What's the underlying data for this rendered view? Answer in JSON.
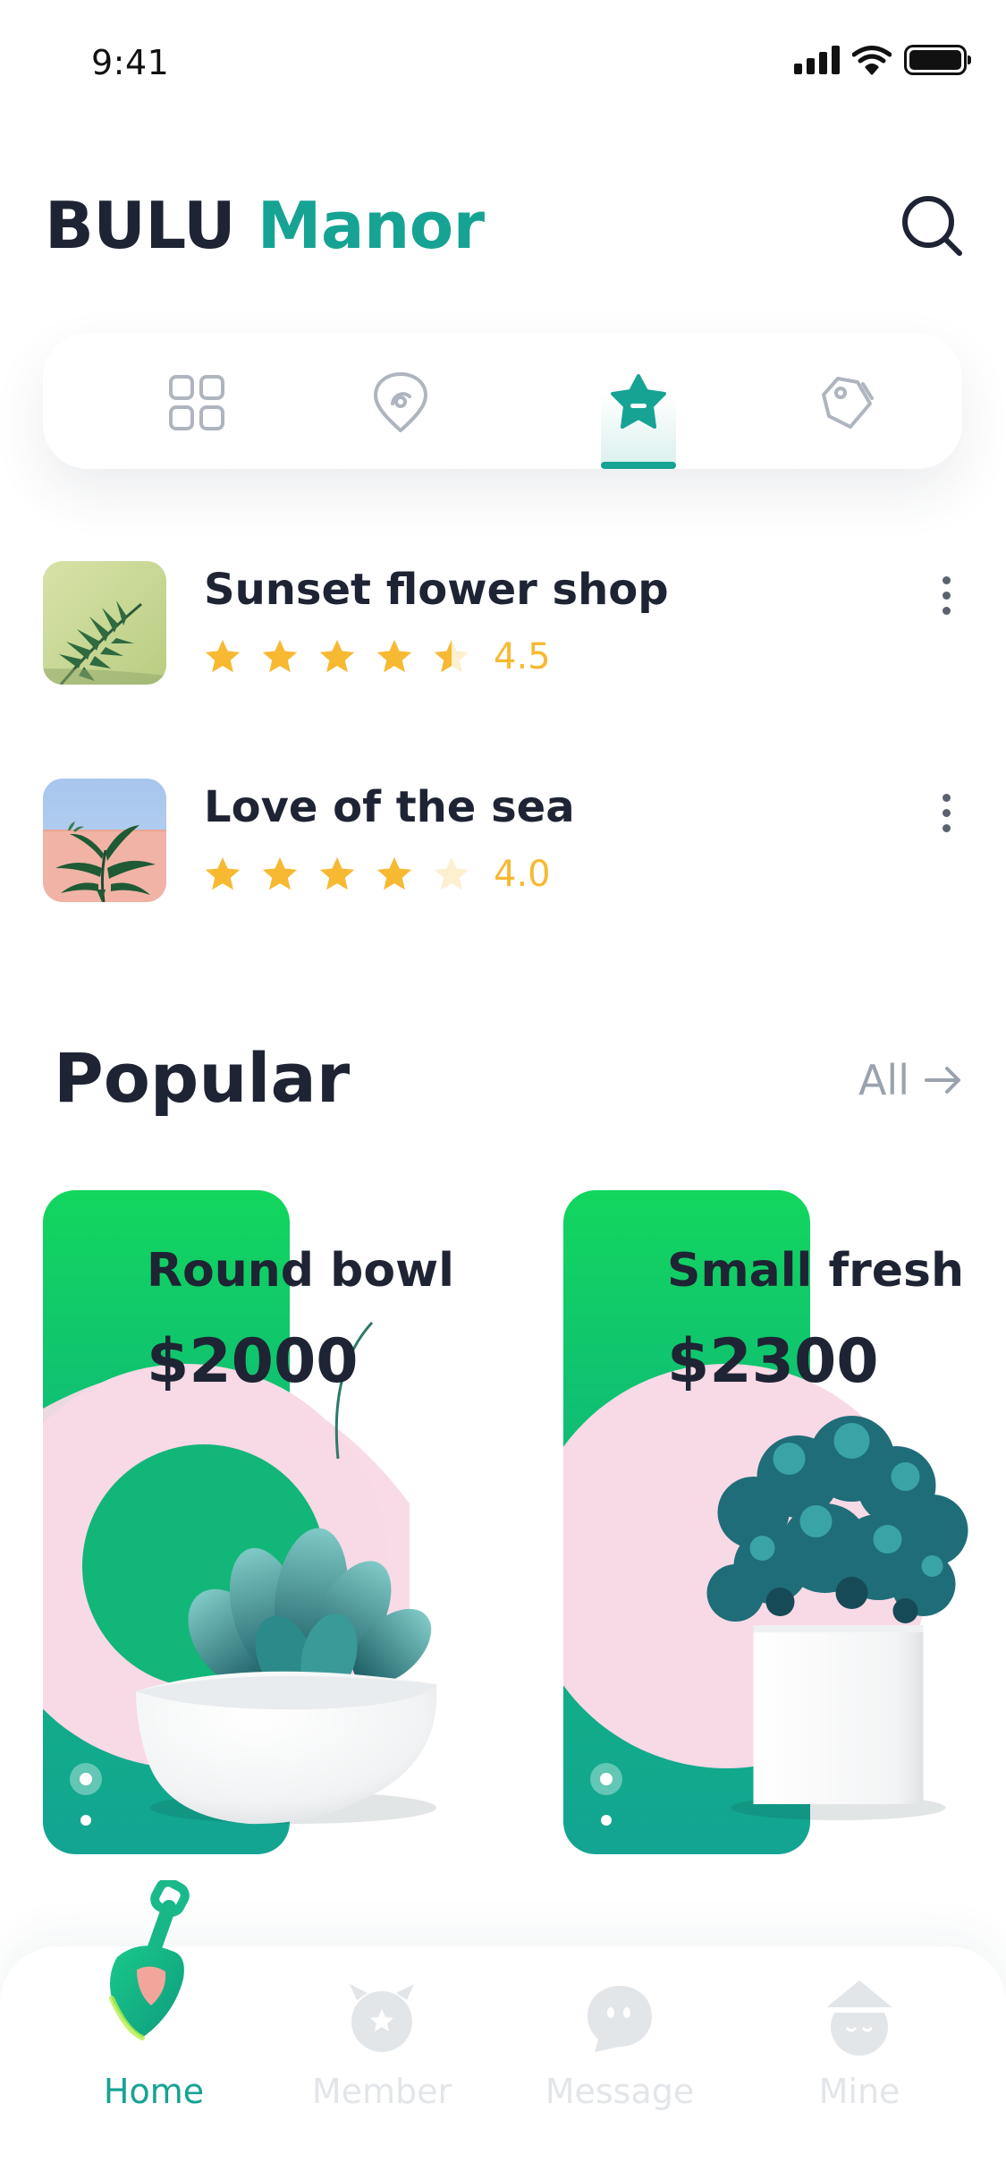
{
  "status_bar": {
    "time": "9:41"
  },
  "header": {
    "brand_first": "BULU",
    "brand_second": "Manor"
  },
  "category_tabs": [
    {
      "icon": "grid-icon",
      "active": false
    },
    {
      "icon": "location-pin-icon",
      "active": false
    },
    {
      "icon": "star-badge-icon",
      "active": true
    },
    {
      "icon": "price-tag-icon",
      "active": false
    }
  ],
  "shops": [
    {
      "name": "Sunset flower shop",
      "rating": "4.5",
      "stars": 4.5
    },
    {
      "name": "Love of the sea",
      "rating": "4.0",
      "stars": 4.0
    }
  ],
  "popular": {
    "title": "Popular",
    "see_all": "All",
    "items": [
      {
        "name": "Round bowl",
        "price": "$2000"
      },
      {
        "name": "Small fresh",
        "price": "$2300"
      }
    ]
  },
  "bottom_nav": [
    {
      "label": "Home",
      "icon": "shovel-icon",
      "active": true
    },
    {
      "label": "Member",
      "icon": "member-icon",
      "active": false
    },
    {
      "label": "Message",
      "icon": "message-icon",
      "active": false
    },
    {
      "label": "Mine",
      "icon": "profile-icon",
      "active": false
    }
  ],
  "colors": {
    "accent": "#16a394",
    "star": "#f7b932",
    "card_green_top": "#12d65e",
    "card_green_bottom": "#13a493",
    "card_pink": "#f8d9e6",
    "text_dark": "#1e2433",
    "muted": "#9aa3ad"
  }
}
